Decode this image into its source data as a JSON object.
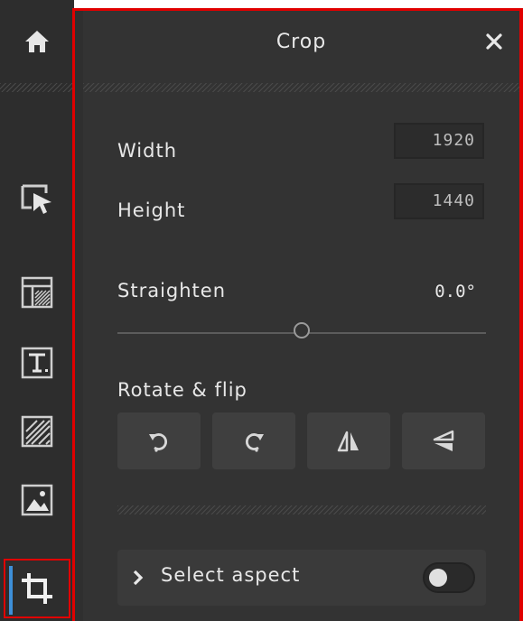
{
  "sidebar": {
    "home_icon": "home-icon",
    "tools": [
      {
        "name": "select-tool",
        "icon": "select-pointer-icon"
      },
      {
        "name": "layout-tool",
        "icon": "layout-icon"
      },
      {
        "name": "text-tool",
        "icon": "text-icon"
      },
      {
        "name": "pattern-tool",
        "icon": "pattern-icon"
      },
      {
        "name": "image-tool",
        "icon": "image-icon"
      },
      {
        "name": "crop-tool",
        "icon": "crop-icon",
        "active": true
      }
    ]
  },
  "panel": {
    "title": "Crop",
    "close_icon": "close-icon",
    "width_label": "Width",
    "width_value": "1920",
    "height_label": "Height",
    "height_value": "1440",
    "straighten_label": "Straighten",
    "straighten_value": "0.0°",
    "straighten_level": 0.5,
    "rotate_flip_label": "Rotate & flip",
    "rotate_buttons": [
      {
        "name": "rotate-left",
        "icon": "rotate-left-icon"
      },
      {
        "name": "rotate-right",
        "icon": "rotate-right-icon"
      },
      {
        "name": "flip-horizontal",
        "icon": "flip-horizontal-icon"
      },
      {
        "name": "flip-vertical",
        "icon": "flip-vertical-icon"
      }
    ],
    "aspect_label": "Select aspect",
    "aspect_toggle_on": false
  },
  "colors": {
    "sidebar_bg": "#2d2d2d",
    "panel_bg": "#333333",
    "highlight": "#e00000",
    "active_marker": "#3d8fd8"
  }
}
